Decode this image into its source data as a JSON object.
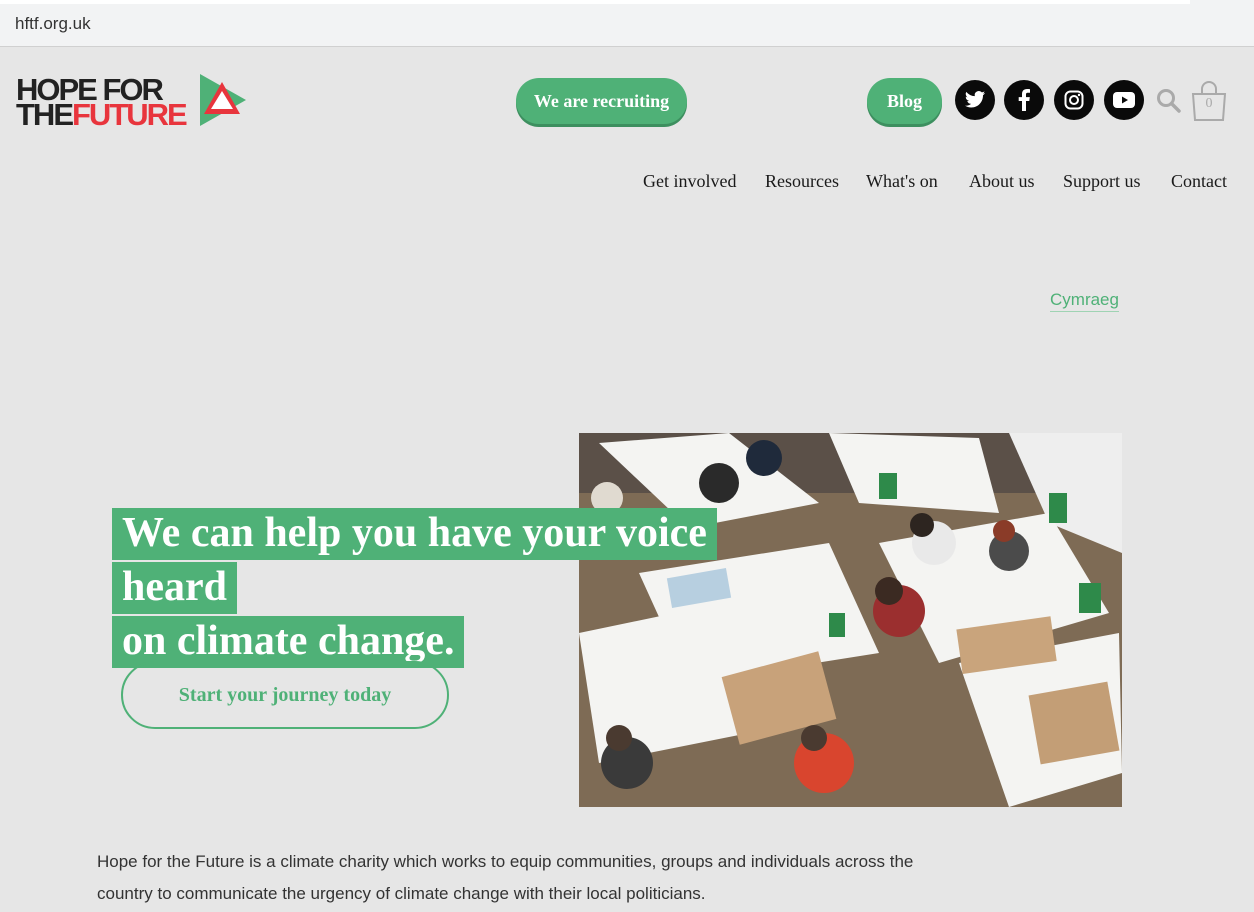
{
  "browser": {
    "url": "hftf.org.uk"
  },
  "logo": {
    "line1": "HOPE FOR",
    "line2_a": "THE",
    "line2_b": "FUTURE"
  },
  "header": {
    "recruit_label": "We are recruiting",
    "blog_label": "Blog",
    "social": [
      "twitter-icon",
      "facebook-icon",
      "instagram-icon",
      "youtube-icon"
    ],
    "basket_count": "0"
  },
  "nav": {
    "items": [
      "Get involved",
      "Resources",
      "What's on",
      "About us",
      "Support us",
      "Contact"
    ]
  },
  "language_link": "Cymraeg",
  "hero": {
    "title_line1": "We can help you have your voice heard",
    "title_line2": "on climate change.",
    "cta_label": "Start your journey today"
  },
  "intro": {
    "line1": "Hope for the Future is a climate charity which works to equip communities, groups and individuals across the",
    "line2": "country to communicate the urgency of climate change with their local politicians."
  },
  "colors": {
    "accent": "#4fb177",
    "logo_red": "#e8353d",
    "background": "#e6e6e6"
  }
}
